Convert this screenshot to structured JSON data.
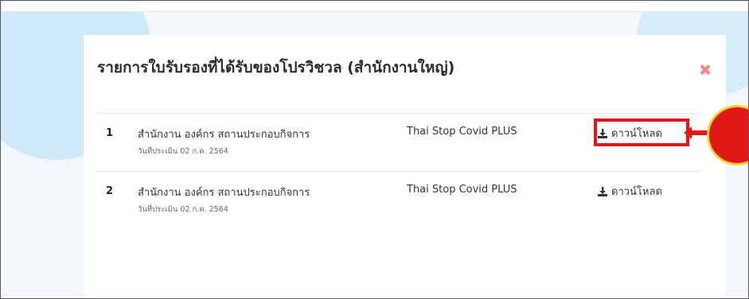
{
  "modal": {
    "title": "รายการใบรับรองที่ได้รับของโปรวิชวล (สำนักงานใหญ่)",
    "close_icon": "close-icon"
  },
  "rows": [
    {
      "number": "1",
      "org_name": "สำนักงาน องค์กร สถานประกอบกิจการ",
      "eval_date": "วันที่ประเมิน 02 ก.ค. 2564",
      "cert_name": "Thai Stop Covid PLUS",
      "download_label": "ดาวน์โหลด",
      "download_icon": "download-icon"
    },
    {
      "number": "2",
      "org_name": "สำนักงาน องค์กร สถานประกอบกิจการ",
      "eval_date": "วันที่ประเมิน 02 ก.ค. 2564",
      "cert_name": "Thai Stop Covid PLUS",
      "download_label": "ดาวน์โหลด",
      "download_icon": "download-icon"
    }
  ],
  "annotation": {
    "highlight_color": "#e21818",
    "callout_border_color": "#ffd22e"
  },
  "colors": {
    "close": "#ef8a8a",
    "background_blob": "#cfe9f8",
    "text": "#333333"
  }
}
